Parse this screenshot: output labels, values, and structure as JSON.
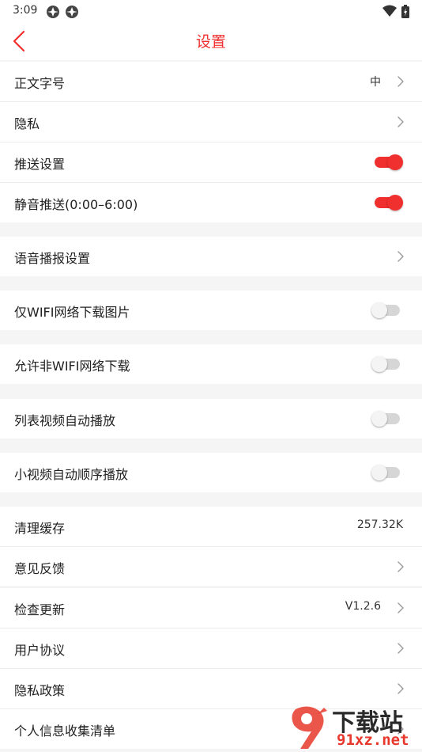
{
  "status_bar": {
    "time": "3:09"
  },
  "header": {
    "title": "设置"
  },
  "rows": [
    {
      "label": "正文字号",
      "value": "中",
      "control": "chevron"
    },
    {
      "label": "隐私",
      "value": "",
      "control": "chevron"
    },
    {
      "label": "推送设置",
      "control": "toggle",
      "on": true
    },
    {
      "label": "静音推送(0:00–6:00)",
      "control": "toggle",
      "on": true
    },
    {
      "label": "语音播报设置",
      "control": "chevron"
    },
    {
      "label": "仅WIFI网络下载图片",
      "control": "toggle",
      "on": false
    },
    {
      "label": "允许非WIFI网络下载",
      "control": "toggle",
      "on": false
    },
    {
      "label": "列表视频自动播放",
      "control": "toggle",
      "on": false
    },
    {
      "label": "小视频自动顺序播放",
      "control": "toggle",
      "on": false
    },
    {
      "label": "清理缓存",
      "value": "257.32K",
      "control": "none"
    },
    {
      "label": "意见反馈",
      "control": "chevron"
    },
    {
      "label": "检查更新",
      "value": "V1.2.6",
      "control": "chevron"
    },
    {
      "label": "用户协议",
      "control": "chevron"
    },
    {
      "label": "隐私政策",
      "control": "chevron"
    },
    {
      "label": "个人信息收集清单",
      "control": "chevron"
    }
  ],
  "watermark": {
    "line1": "下载站",
    "line2": "91xz.net"
  },
  "colors": {
    "accent": "#f0302e",
    "background": "#f5f5f5",
    "row_background": "#ffffff",
    "toggle_off": "#d6d6d6"
  }
}
